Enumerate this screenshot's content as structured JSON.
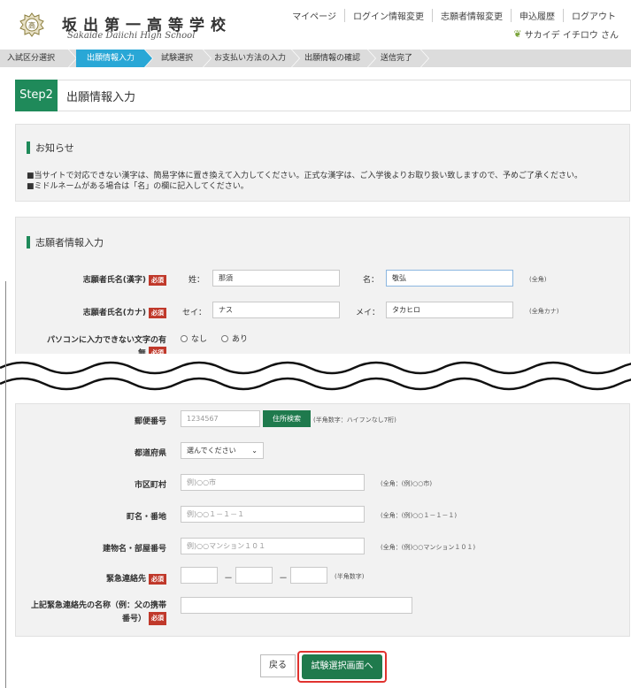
{
  "header": {
    "school_name": "坂出第一高等学校",
    "school_roman": "Sakaide Daiichi High School",
    "nav": [
      "マイページ",
      "ログイン情報変更",
      "志願者情報変更",
      "申込履歴",
      "ログアウト"
    ],
    "user_name": "サカイデ イチロウ さん",
    "leaf_icon": "leaf-icon"
  },
  "breadcrumbs": [
    "入試区分選択",
    "出願情報入力",
    "試験選択",
    "お支払い方法の入力",
    "出願情報の確認",
    "送信完了"
  ],
  "step": {
    "badge": "Step2",
    "title": "出願情報入力"
  },
  "notice": {
    "title": "お知らせ",
    "lines": [
      "■当サイトで対応できない漢字は、簡易字体に置き換えて入力してください。正式な漢字は、ご入学後よりお取り扱い致しますので、予めご了承ください。",
      "■ミドルネームがある場合は「名」の欄に記入してください。"
    ]
  },
  "form": {
    "title": "志願者情報入力",
    "required_label": "必須",
    "name_kanji": {
      "label": "志願者氏名(漢字)",
      "sei_label": "姓：",
      "mei_label": "名：",
      "sei_value": "那須",
      "mei_value": "敬弘",
      "hint": "(全角)"
    },
    "name_kana": {
      "label": "志願者氏名(カナ)",
      "sei_label": "セイ：",
      "mei_label": "メイ：",
      "sei_value": "ナス",
      "mei_value": "タカヒロ",
      "hint": "(全角カナ)"
    },
    "unsupported_chars": {
      "label_line1": "パソコンに入力できない文字の有",
      "label_line2": "無",
      "option_none": "なし",
      "option_yes": "あり"
    },
    "postal": {
      "label": "郵便番号",
      "placeholder": "1234567",
      "button": "住所検索",
      "hint": "(半角数字：ハイフンなし7桁)"
    },
    "prefecture": {
      "label": "都道府県",
      "selected": "選んでください"
    },
    "city": {
      "label": "市区町村",
      "placeholder": "例)○○市",
      "hint": "(全角：(例)○○市)"
    },
    "street": {
      "label": "町名・番地",
      "placeholder": "例)○○１－１－１",
      "hint": "(全角：(例)○○１－１－１)"
    },
    "building": {
      "label": "建物名・部屋番号",
      "placeholder": "例)○○マンション１０１",
      "hint": "(全角：(例)○○マンション１０１)"
    },
    "emergency": {
      "label": "緊急連絡先",
      "dash": "－",
      "hint": "(半角数字)"
    },
    "emergency_name": {
      "label_line1": "上記緊急連絡先の名称（例：父の携帯",
      "label_line2": "番号）"
    }
  },
  "buttons": {
    "back": "戻る",
    "next": "試験選択画面へ"
  },
  "colors": {
    "accent_green": "#1f8a5a",
    "breadcrumb_active": "#29a7d6",
    "required_red": "#c0392b",
    "highlight_red": "#e0332f"
  }
}
